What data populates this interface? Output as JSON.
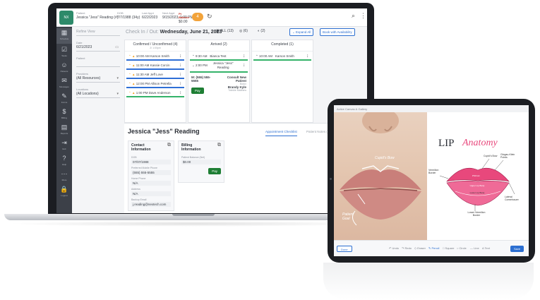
{
  "colors": {
    "accent": "#2c6fd1",
    "sidebar": "#3c4048",
    "appt_blue": "#2f6fd6",
    "appt_green": "#34b36a",
    "pay_green": "#1e7e34",
    "lip_pink": "#e8487c"
  },
  "topbar": {
    "patient_label": "Patient",
    "patient_value": "Jessica \"Jess\" Reading (#)",
    "dob_label": "DOB",
    "dob_value": "7/7/1988 (34y)",
    "last_appt_label": "Last Appt",
    "last_appt_value": "6/22/2023",
    "next_appt_label": "Next Appt",
    "next_appt_value": "9/15/2023, 1:00 PM",
    "balance_label": "Pt Balance",
    "balance_value": "$0.00",
    "bell_count": "4",
    "icons": {
      "refresh": "refresh-icon",
      "search": "search-icon",
      "more": "more-vertical-icon"
    }
  },
  "sidebar": {
    "items": [
      {
        "label": "Schedule",
        "icon": "calendar-icon"
      },
      {
        "label": "Tasks",
        "icon": "clipboard-icon"
      },
      {
        "label": "Patients",
        "icon": "users-icon"
      },
      {
        "label": "Messages",
        "icon": "mail-icon"
      },
      {
        "label": "Forms",
        "icon": "forms-icon"
      },
      {
        "label": "Billing",
        "icon": "dollar-icon"
      },
      {
        "label": "Reports",
        "icon": "chart-icon"
      },
      {
        "label": "Exit",
        "icon": "exit-icon"
      },
      {
        "label": "Help",
        "icon": "help-icon"
      },
      {
        "label": "More",
        "icon": "more-icon"
      },
      {
        "label": "Logout",
        "icon": "lock-icon"
      }
    ]
  },
  "filters": {
    "search_placeholder": "Refine View",
    "date_label": "Date",
    "date_value": "6/21/2023",
    "patient_label": "Patient",
    "patient_value": "",
    "provider_label": "Providers",
    "provider_value": "(All Resources)",
    "location_label": "Locations",
    "location_value": "(All Locations)"
  },
  "checkin": {
    "title_prefix": "Check In / Out:",
    "title_date": "Wednesday, June 21, 2023",
    "all_chip": "ALL (13)",
    "sched_chip": "(6)",
    "complete_chip": "(2)",
    "expand_all": "Expand All",
    "book_with_availability": "Book with Availability",
    "columns": [
      {
        "title": "Confirmed / Unconfirmed (4)",
        "subtitle": "2/ 1:00pm",
        "appointments": [
          {
            "time": "10:00 AM",
            "name": "Karson Smith",
            "color": "blue"
          },
          {
            "time": "11:00 AM",
            "name": "Kassie Corcin",
            "color": "blue"
          },
          {
            "time": "11:30 AM",
            "name": "Jeff Love",
            "color": "blue"
          },
          {
            "time": "12:00 PM",
            "name": "Allison Petrella",
            "color": "blue"
          },
          {
            "time": "1:00 PM",
            "name": "Dave Anderson",
            "color": "green"
          }
        ]
      },
      {
        "title": "Arrived (2)",
        "subtitle": "",
        "appointments": [
          {
            "time": "9:30 AM",
            "name": "Bianca Test",
            "color": "green"
          },
          {
            "time": "2:00 PM",
            "name": "Jessica \"Jess\" Reading",
            "color": "green"
          }
        ],
        "card": {
          "title": "M: (555) 555-5555",
          "type": "Consult New Patient",
          "room": "Botox",
          "provider": "Brandy Kyle",
          "note": "Twinkle Matthew",
          "pay": "Pay"
        }
      },
      {
        "title": "Completed (1)",
        "subtitle": "",
        "appointments": [
          {
            "time": "10:00 AM",
            "name": "Karson Smith",
            "color": "green"
          }
        ]
      }
    ]
  },
  "patient_panel": {
    "name": "Jessica \"Jess\" Reading",
    "tabs": [
      "Appointment Checklist",
      "Patient Notes (1)"
    ],
    "contact": {
      "title": "Contact Information",
      "fields": [
        {
          "label": "DOB",
          "value": "07/07/1988"
        },
        {
          "label": "Preferred Mobile Phone",
          "value": "(555) 555-5555"
        },
        {
          "label": "Home Phone",
          "value": "N/A"
        },
        {
          "label": "Address",
          "value": "N/A"
        },
        {
          "label": "Backup Email",
          "value": "j.reading@nextech.com"
        }
      ]
    },
    "billing": {
      "title": "Billing Information",
      "fields": [
        {
          "label": "Patient Balance (Net)",
          "value": "$0.00"
        }
      ],
      "pay": "Pay"
    }
  },
  "tablet": {
    "title": "Active Canvas & Gallery",
    "photo_annotations": [
      "Cupid's Bow",
      "Patient Goal"
    ],
    "diagram": {
      "title_lip": "LIP",
      "title_anatomy": "Anatomy",
      "labels": {
        "cupids_bow": "Cupid's Bow",
        "glogau_klein": "Glogau-Klein Points",
        "vermilion_border": "Vermilion Border",
        "philtrum": "Philtrum",
        "upper_lip_body": "Upper Lip Body",
        "lower_lip_body": "Lower Lip Body",
        "lateral_commissure": "Lateral Commissure",
        "lower_vermilion_border": "Lower Vermilion Border"
      }
    },
    "toolbar": {
      "cancel": "Done",
      "tools": [
        "Undo",
        "Redo",
        "Eraser",
        "Pencil",
        "Square",
        "Circle",
        "Line",
        "Text"
      ],
      "save": "Save"
    }
  }
}
